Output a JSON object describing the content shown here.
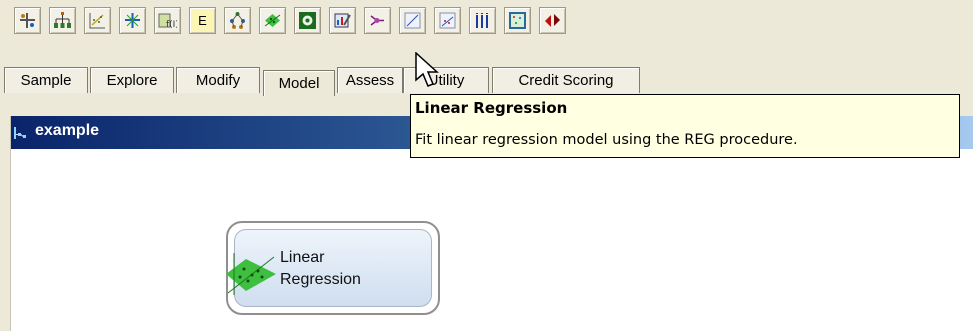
{
  "toolbar": {
    "buttons": [
      {
        "icon": "sample-node-icon"
      },
      {
        "icon": "tree-icon"
      },
      {
        "icon": "scatter-down-icon"
      },
      {
        "icon": "cluster-icon"
      },
      {
        "icon": "formula-icon"
      },
      {
        "icon": "e-text-icon",
        "label": "E"
      },
      {
        "icon": "network-icon"
      },
      {
        "icon": "linear-regression-icon"
      },
      {
        "icon": "gear-disc-icon"
      },
      {
        "icon": "chart-edit-icon"
      },
      {
        "icon": "neural-net-icon"
      },
      {
        "icon": "line-fit-icon"
      },
      {
        "icon": "scatter-fit-icon"
      },
      {
        "icon": "bars-icon"
      },
      {
        "icon": "grid-dots-icon"
      },
      {
        "icon": "red-arrows-icon"
      }
    ]
  },
  "tabs": [
    "Sample",
    "Explore",
    "Modify",
    "Model",
    "Assess",
    "Utility",
    "Credit Scoring"
  ],
  "active_tab": "Model",
  "panel": {
    "title": "example"
  },
  "node": {
    "label_line1": "Linear",
    "label_line2": "Regression"
  },
  "tooltip": {
    "title": "Linear Regression",
    "body": "Fit linear regression model using the REG procedure."
  },
  "colors": {
    "title_bar": "#0a246a",
    "tooltip_bg": "#ffffe1",
    "node_fill": "#cfdeef",
    "regression_green": "#3fbf3f"
  }
}
